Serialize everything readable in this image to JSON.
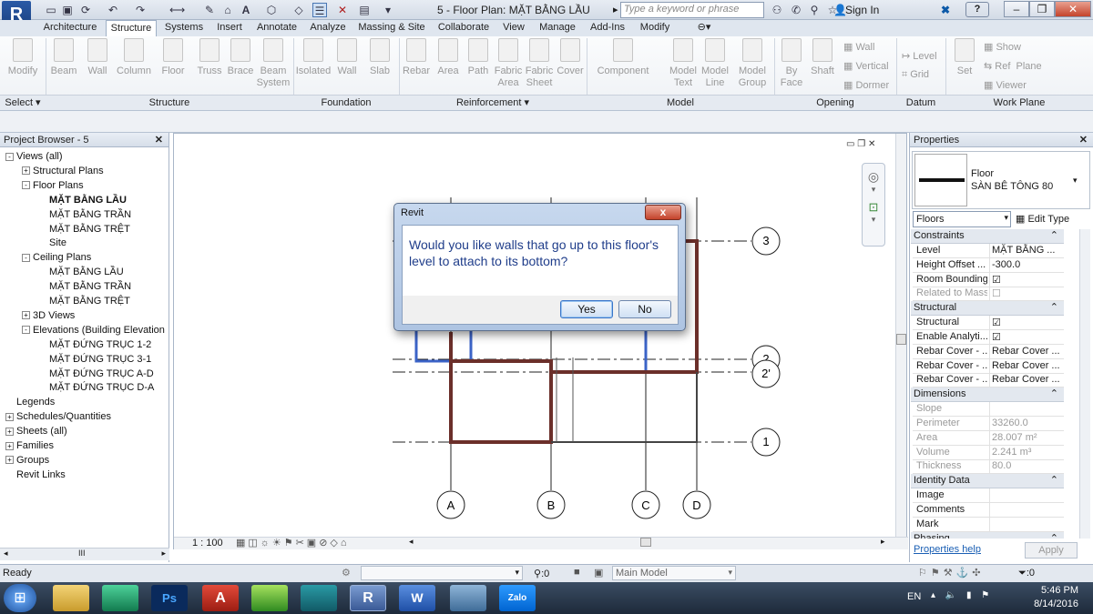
{
  "app": {
    "logo": "R",
    "title": "5 - Floor Plan: MẶT BẰNG LẦU",
    "search_placeholder": "Type a keyword or phrase",
    "sign_in": "Sign In",
    "help": "?"
  },
  "tabs": [
    "Architecture",
    "Structure",
    "Systems",
    "Insert",
    "Annotate",
    "Analyze",
    "Massing & Site",
    "Collaborate",
    "View",
    "Manage",
    "Add-Ins",
    "Modify"
  ],
  "active_tab": "Structure",
  "ribbon": {
    "buttons": [
      {
        "label": "Modify"
      },
      {
        "label": "Beam"
      },
      {
        "label": "Wall"
      },
      {
        "label": "Column"
      },
      {
        "label": "Floor"
      },
      {
        "label": "Truss"
      },
      {
        "label": "Brace"
      },
      {
        "label": "Beam\nSystem"
      },
      {
        "label": "Isolated"
      },
      {
        "label": "Wall"
      },
      {
        "label": "Slab"
      },
      {
        "label": "Rebar"
      },
      {
        "label": "Area"
      },
      {
        "label": "Path"
      },
      {
        "label": "Fabric\nArea"
      },
      {
        "label": "Fabric\nSheet"
      },
      {
        "label": "Cover"
      },
      {
        "label": "Component"
      },
      {
        "label": "Model\nText"
      },
      {
        "label": "Model\nLine"
      },
      {
        "label": "Model\nGroup"
      },
      {
        "label": "By\nFace"
      },
      {
        "label": "Shaft"
      }
    ],
    "small_buttons": [
      "Wall",
      "Vertical",
      "Dormer",
      "Level",
      "Grid",
      "Set",
      "Show",
      "Ref  Plane",
      "Viewer"
    ],
    "panels": [
      "Select",
      "Structure",
      "Foundation",
      "Reinforcement",
      "Model",
      "Opening",
      "Datum",
      "Work Plane"
    ]
  },
  "project_browser": {
    "title": "Project Browser - 5",
    "items": [
      {
        "label": "Views (all)",
        "level": 0,
        "exp": "-"
      },
      {
        "label": "Structural Plans",
        "level": 1,
        "exp": "+"
      },
      {
        "label": "Floor Plans",
        "level": 1,
        "exp": "-"
      },
      {
        "label": "MẶT BẰNG LẦU",
        "level": 2,
        "exp": "",
        "bold": true
      },
      {
        "label": "MẶT BẰNG TRẦN",
        "level": 2,
        "exp": ""
      },
      {
        "label": "MẶT BẰNG TRỆT",
        "level": 2,
        "exp": ""
      },
      {
        "label": "Site",
        "level": 2,
        "exp": ""
      },
      {
        "label": "Ceiling Plans",
        "level": 1,
        "exp": "-"
      },
      {
        "label": "MẶT BẰNG LẦU",
        "level": 2,
        "exp": ""
      },
      {
        "label": "MẶT BẰNG TRẦN",
        "level": 2,
        "exp": ""
      },
      {
        "label": "MẶT BẰNG TRỆT",
        "level": 2,
        "exp": ""
      },
      {
        "label": "3D Views",
        "level": 1,
        "exp": "+"
      },
      {
        "label": "Elevations (Building Elevation",
        "level": 1,
        "exp": "-"
      },
      {
        "label": "MẶT ĐỨNG TRỤC 1-2",
        "level": 2,
        "exp": ""
      },
      {
        "label": "MẶT ĐỨNG TRỤC 3-1",
        "level": 2,
        "exp": ""
      },
      {
        "label": "MẶT ĐỨNG TRỤC A-D",
        "level": 2,
        "exp": ""
      },
      {
        "label": "MẶT ĐỨNG TRỤC D-A",
        "level": 2,
        "exp": ""
      },
      {
        "label": "Legends",
        "level": 0,
        "exp": ""
      },
      {
        "label": "Schedules/Quantities",
        "level": 0,
        "exp": "+"
      },
      {
        "label": "Sheets (all)",
        "level": 0,
        "exp": "+"
      },
      {
        "label": "Families",
        "level": 0,
        "exp": "+"
      },
      {
        "label": "Groups",
        "level": 0,
        "exp": "+"
      },
      {
        "label": "Revit Links",
        "level": 0,
        "exp": ""
      }
    ]
  },
  "canvas": {
    "grid_labels": [
      "A",
      "B",
      "C",
      "D",
      "1",
      "2",
      "2'",
      "3"
    ],
    "scale": "1 : 100"
  },
  "dialog": {
    "title": "Revit",
    "message": "Would you like walls that go up to this floor's level to attach to its bottom?",
    "yes": "Yes",
    "no": "No",
    "close": "x"
  },
  "properties": {
    "title": "Properties",
    "type_family": "Floor",
    "type_name": "SÀN BÊ TÔNG 80",
    "selector": "Floors",
    "edit_type": "Edit Type",
    "groups": [
      {
        "name": "Constraints",
        "rows": [
          {
            "k": "Level",
            "v": "MẶT BẰNG ..."
          },
          {
            "k": "Height Offset ...",
            "v": "-300.0"
          },
          {
            "k": "Room Bounding",
            "v": "☑"
          },
          {
            "k": "Related to Mass",
            "v": "☐",
            "dim": true
          }
        ]
      },
      {
        "name": "Structural",
        "rows": [
          {
            "k": "Structural",
            "v": "☑"
          },
          {
            "k": "Enable Analyti...",
            "v": "☑"
          },
          {
            "k": "Rebar Cover - ...",
            "v": "Rebar Cover ..."
          },
          {
            "k": "Rebar Cover - ...",
            "v": "Rebar Cover ..."
          },
          {
            "k": "Rebar Cover - ...",
            "v": "Rebar Cover ..."
          }
        ]
      },
      {
        "name": "Dimensions",
        "rows": [
          {
            "k": "Slope",
            "v": "",
            "dim": true
          },
          {
            "k": "Perimeter",
            "v": "33260.0",
            "dim": true
          },
          {
            "k": "Area",
            "v": "28.007 m²",
            "dim": true
          },
          {
            "k": "Volume",
            "v": "2.241 m³",
            "dim": true
          },
          {
            "k": "Thickness",
            "v": "80.0",
            "dim": true
          }
        ]
      },
      {
        "name": "Identity Data",
        "rows": [
          {
            "k": "Image",
            "v": ""
          },
          {
            "k": "Comments",
            "v": ""
          },
          {
            "k": "Mark",
            "v": ""
          }
        ]
      },
      {
        "name": "Phasing",
        "rows": []
      }
    ],
    "help_link": "Properties help",
    "apply": "Apply"
  },
  "status": {
    "text": "Ready",
    "filter_count": ":0",
    "model": "Main Model",
    "sel_count": ":0"
  },
  "taskbar": {
    "lang": "EN",
    "time": "5:46 PM",
    "date": "8/14/2016"
  }
}
